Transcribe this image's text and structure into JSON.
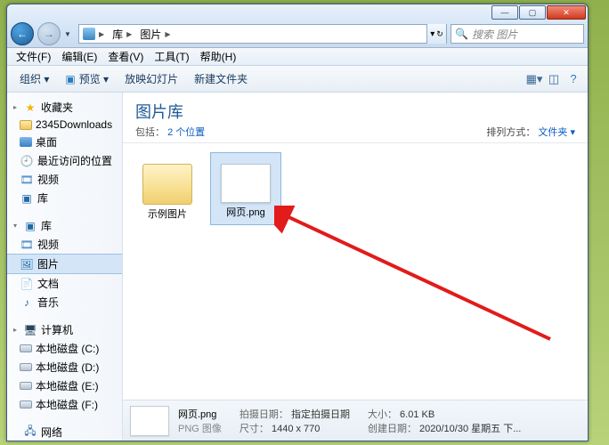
{
  "titlebar": {
    "min": "—",
    "max": "▢",
    "close": "✕"
  },
  "nav": {
    "crumb_root": "库",
    "crumb_lib": "图片",
    "refresh": "↻",
    "search_placeholder": "搜索 图片",
    "search_icon": "🔍"
  },
  "menu": {
    "file": "文件(F)",
    "edit": "编辑(E)",
    "view": "查看(V)",
    "tools": "工具(T)",
    "help": "帮助(H)"
  },
  "toolbar": {
    "organize": "组织 ▾",
    "preview": "预览 ▾",
    "slideshow": "放映幻灯片",
    "newfolder": "新建文件夹"
  },
  "sidebar": {
    "favorites": "收藏夹",
    "fav_items": {
      "downloads": "2345Downloads",
      "desktop": "桌面",
      "recent": "最近访问的位置",
      "videos": "视频",
      "libraries": "库"
    },
    "libs_head": "库",
    "libs": {
      "video": "视频",
      "pictures": "图片",
      "docs": "文档",
      "music": "音乐"
    },
    "computer": "计算机",
    "drives": {
      "c": "本地磁盘 (C:)",
      "d": "本地磁盘 (D:)",
      "e": "本地磁盘 (E:)",
      "f": "本地磁盘 (F:)"
    },
    "network": "网络"
  },
  "libheader": {
    "title": "图片库",
    "includes_label": "包括：",
    "includes_link": "2 个位置",
    "arrange_label": "排列方式：",
    "arrange_value": "文件夹 ▾"
  },
  "items": {
    "sample_pics": "示例图片",
    "webpage_png": "网页.png"
  },
  "details": {
    "filename": "网页.png",
    "type": "PNG 图像",
    "date_taken_label": "拍摄日期：",
    "date_taken_value": "指定拍摄日期",
    "dimensions_label": "尺寸：",
    "dimensions_value": "1440 x 770",
    "size_label": "大小：",
    "size_value": "6.01 KB",
    "created_label": "创建日期：",
    "created_value": "2020/10/30 星期五 下..."
  }
}
